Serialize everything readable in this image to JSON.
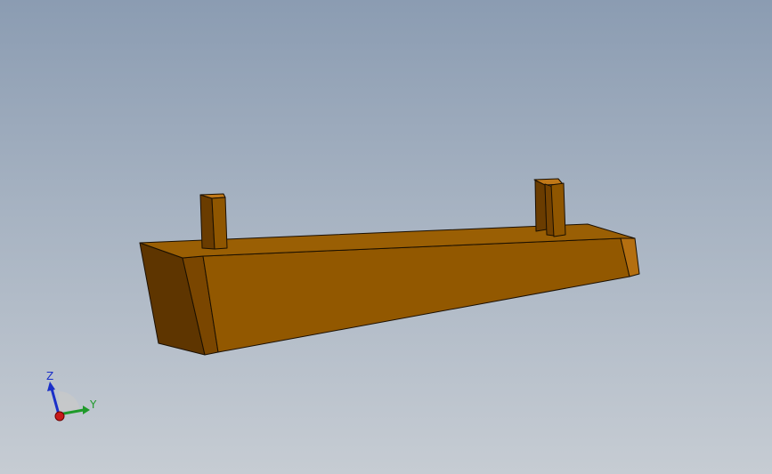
{
  "viewport": {
    "model_name": "wooden-beam-with-two-tabs",
    "colors": {
      "background_top": "#8b9cb2",
      "background_bottom": "#c6ccd3",
      "front_face": "#925800",
      "top_face": "#9a5f04",
      "left_face": "#5e3500",
      "end_face": "#b46f10",
      "edge": "#1a0f00"
    }
  },
  "triad": {
    "z_label": "Z",
    "y_label": "Y",
    "z_color": "#1a2fc8",
    "y_color": "#1f9a2a",
    "x_color": "#c81a1a"
  }
}
